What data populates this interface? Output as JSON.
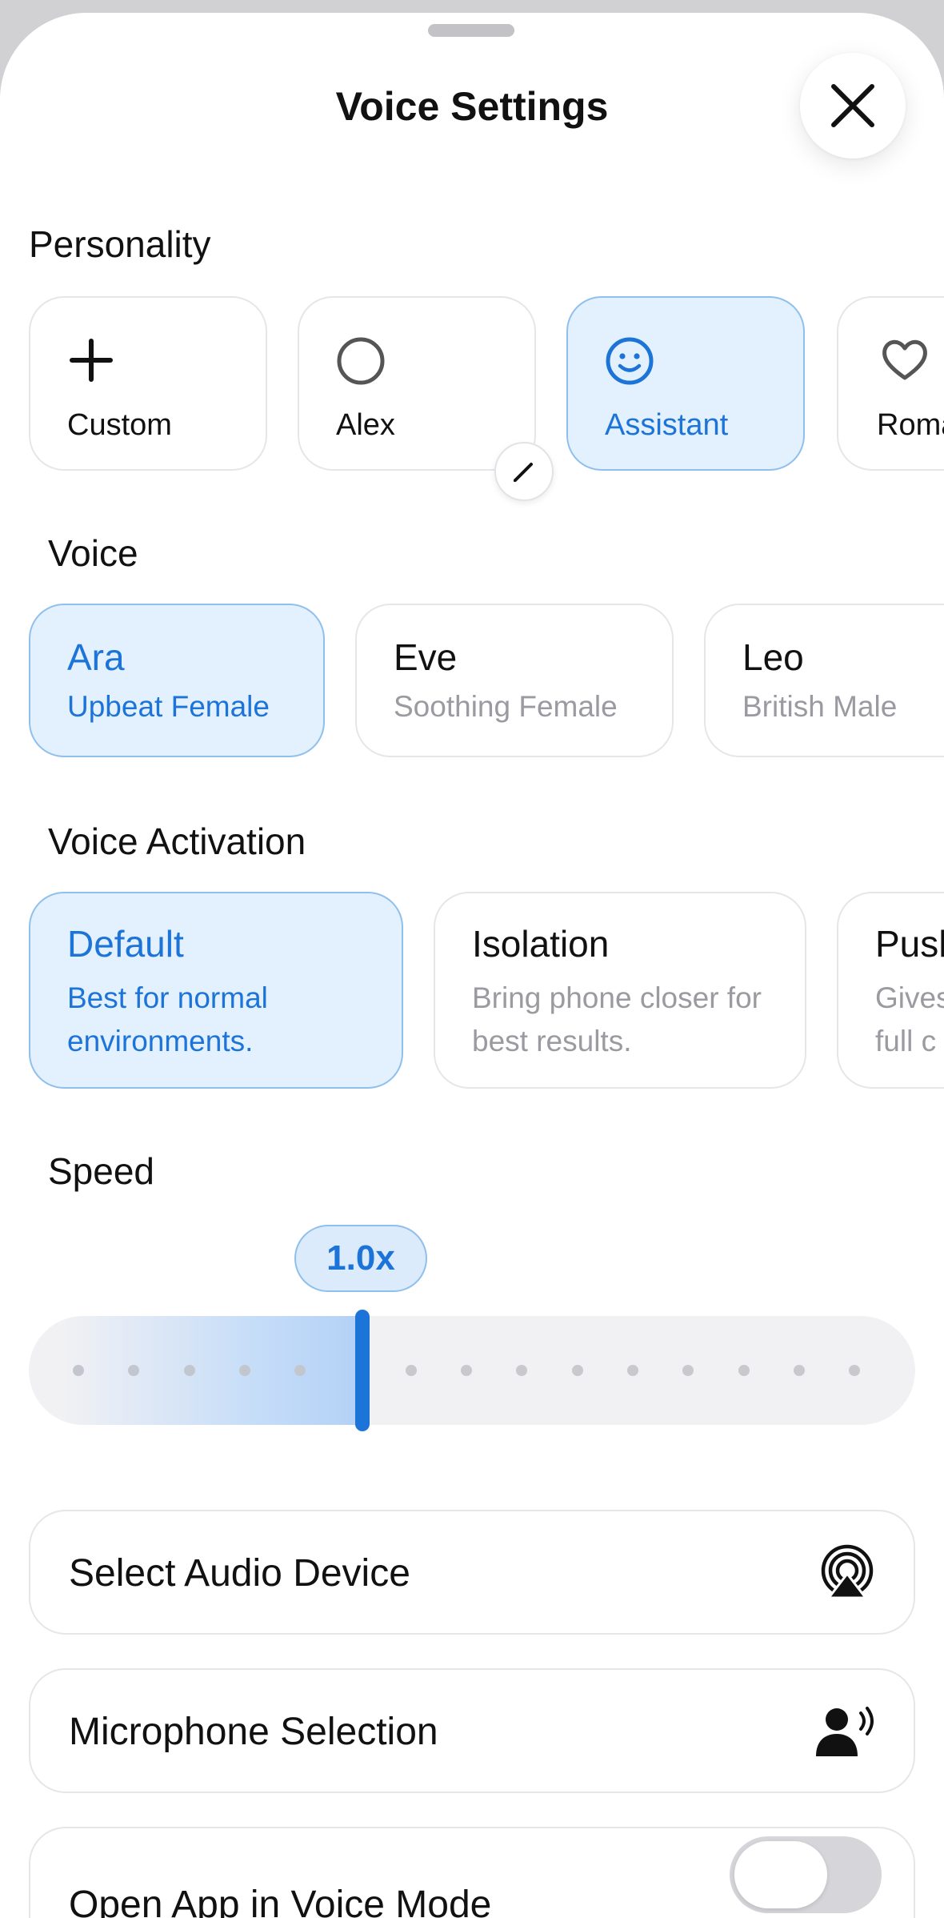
{
  "title": "Voice Settings",
  "personality": {
    "label": "Personality",
    "items": [
      {
        "label": "Custom",
        "icon": "plus-icon",
        "selected": false
      },
      {
        "label": "Alex",
        "icon": "circle-icon",
        "selected": false,
        "editable": true
      },
      {
        "label": "Assistant",
        "icon": "smiley-icon",
        "selected": true
      },
      {
        "label": "Roma",
        "icon": "heart-icon",
        "selected": false
      }
    ]
  },
  "voice": {
    "label": "Voice",
    "items": [
      {
        "name": "Ara",
        "desc": "Upbeat Female",
        "selected": true
      },
      {
        "name": "Eve",
        "desc": "Soothing Female",
        "selected": false
      },
      {
        "name": "Leo",
        "desc": "British Male",
        "selected": false
      }
    ]
  },
  "activation": {
    "label": "Voice Activation",
    "items": [
      {
        "name": "Default",
        "desc": "Best for normal environments.",
        "selected": true
      },
      {
        "name": "Isolation",
        "desc": "Bring phone closer for best results.",
        "selected": false
      },
      {
        "name": "Push",
        "desc": "Gives full c",
        "selected": false
      }
    ]
  },
  "speed": {
    "label": "Speed",
    "value_label": "1.0x",
    "position_fraction": 0.376
  },
  "rows": [
    {
      "label": "Select Audio Device",
      "icon": "airplay-audio-icon"
    },
    {
      "label": "Microphone Selection",
      "icon": "person-speaking-icon"
    },
    {
      "label": "Open App in Voice Mode",
      "icon": "toggle-switch",
      "toggle_on": false
    }
  ],
  "colors": {
    "accent": "#1d74d8",
    "selected_bg": "#e3f0fd",
    "selected_border": "#8ec0eb"
  }
}
